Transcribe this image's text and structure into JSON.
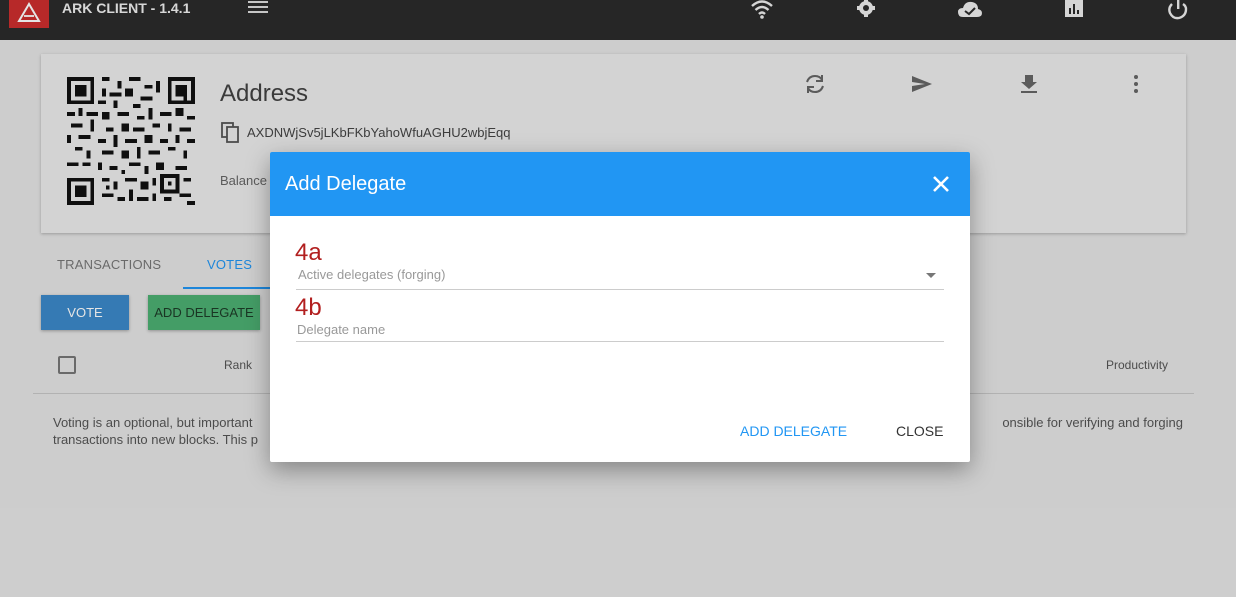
{
  "app": {
    "title": "ARK CLIENT - 1.4.1"
  },
  "topbar": {
    "icons": [
      "menu-icon",
      "wifi-icon",
      "gear-icon",
      "cloud-done-icon",
      "bar-chart-icon",
      "power-icon"
    ]
  },
  "wallet": {
    "title": "Address",
    "address": "AXDNWjSv5jLKbFKbYahoWfuAGHU2wbjEqq",
    "balance_label": "Balance",
    "action_icons": [
      "refresh-icon",
      "send-icon",
      "download-icon",
      "more-vert-icon"
    ]
  },
  "tabs": [
    {
      "label": "TRANSACTIONS",
      "active": false
    },
    {
      "label": "VOTES",
      "active": true
    }
  ],
  "actions": {
    "vote_label": "VOTE",
    "add_delegate_label": "ADD DELEGATE"
  },
  "table": {
    "columns": [
      "Rank",
      "Productivity"
    ]
  },
  "info": {
    "line1_start": "Voting is an optional, but important",
    "line1_end": "onsible for verifying and forging",
    "line2_start": "transactions into new blocks. This p"
  },
  "dialog": {
    "title": "Add Delegate",
    "annotation_a": "4a",
    "annotation_b": "4b",
    "select_placeholder": "Active delegates (forging)",
    "input_placeholder": "Delegate name",
    "add_label": "ADD DELEGATE",
    "close_label": "CLOSE"
  },
  "colors": {
    "topbar": "#2b2b2b",
    "brand": "#cc2e2e",
    "accent": "#2196f3",
    "vote_button": "#3b88c9",
    "add_button": "#4caf72",
    "annotation": "#b21f1f"
  }
}
